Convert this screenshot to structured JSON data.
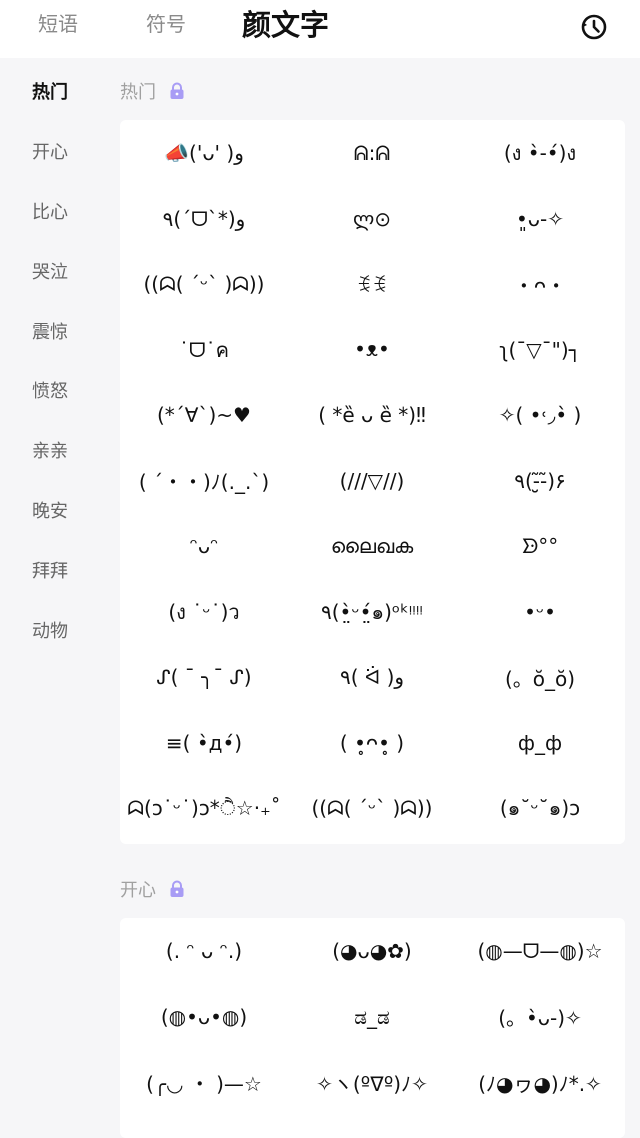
{
  "tabs": [
    {
      "label": "短语"
    },
    {
      "label": "符号"
    },
    {
      "label": "颜文字"
    }
  ],
  "sidebar": {
    "items": [
      {
        "label": "热门"
      },
      {
        "label": "开心"
      },
      {
        "label": "比心"
      },
      {
        "label": "哭泣"
      },
      {
        "label": "震惊"
      },
      {
        "label": "愤怒"
      },
      {
        "label": "亲亲"
      },
      {
        "label": "晚安"
      },
      {
        "label": "拜拜"
      },
      {
        "label": "动物"
      }
    ]
  },
  "sections": [
    {
      "title": "热门",
      "icon": "lock-icon",
      "items": [
        "📣('ᴗ' )و",
        "ᕱ:ᕱ",
        "(ง •̀-•́)ง",
        "٩(ˊᗜˋ*)و",
        "ლ⊙",
        "•͈ᴗ-✧",
        "((ᗣ( ˊᵕˋ )ᗣ))",
        "ꉂꉂ",
        "・ᴖ・",
        "˙ᗜ˙ค",
        "•ᴥ•",
        "ʅ(¯▽¯\")┐",
        "(*´∀`)~♥",
        "( *ȅ ᴗ ȅ *)‼",
        "✧( •˓◞•̀ )",
        "( ´・・)ﾉ(._.`)",
        "(///▽//)",
        "٩(-̮̮̃-̃)۶",
        "ᵔᴗᵔ",
        "ലൈഖക",
        "ᗦ°°",
        "(ง ˙ᵕ˙)ว",
        "٩(•̤̀ᵕ•̤́๑)ᵒᵏᵎᵎᵎᵎ",
        "•ᵕ•",
        "ᔑ( ¯ ╮¯ ᔑ)",
        "٩( ᐛ )و",
        "(。ŏ_ŏ)",
        "≡( •̀д•́)",
        "( •̥ᴖ•̥ )",
        "ф_ф",
        "ᗣ(ɔ˙ᵕ˙)ɔ*ੈ☆‧₊˚",
        "((ᗣ( ˊᵕˋ )ᗣ))",
        "(๑˘ᵕ˘๑)ɔ"
      ]
    },
    {
      "title": "开心",
      "icon": "lock-icon",
      "items": [
        "(. ᵔ ᴗ ᵔ.)",
        "(◕ᴗ◕✿)",
        "(◍—ᗜ—◍)☆",
        "(◍•ᴗ•◍)",
        "ಡ_ಡ",
        "(。•̀ᴗ-)✧",
        "(╭◡ ・ )—☆",
        "✧ヽ(ºᐁº)ﾉ✧",
        "(ﾉ◕ヮ◕)ﾉ*.✧"
      ]
    }
  ],
  "colors": {
    "accent": "#b9b3ff",
    "lock": "#a89cf5"
  }
}
